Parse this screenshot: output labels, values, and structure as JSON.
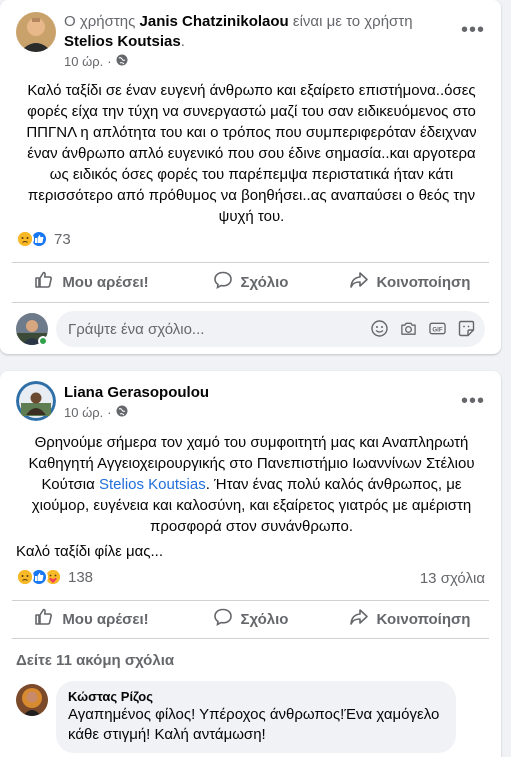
{
  "post1": {
    "header_prefix": "Ο χρήστης",
    "author": "Janis Chatzinikolaou",
    "header_middle": "είναι με το χρήστη",
    "tagged": "Stelios Koutsias",
    "header_suffix": ".",
    "time": "10 ώρ.",
    "text": "Καλό ταξίδι σε έναν ευγενή άνθρωπο και εξαίρετο επιστήμονα..όσες φορές είχα την τύχη να συνεργαστώ μαζί του σαν ειδικευόμενος στο ΠΠΓΝΛ η απλότητα του και ο τρόπος που συμπεριφερόταν έδειχναν έναν άνθρωπο απλό ευγενικό που σου έδινε σημασία..και αργοτερα ως ειδικός όσες φορές του παρέπεμψα περιστατικά ήταν κάτι περισσότερο από πρόθυμος να βοηθήσει..ας αναπαύσει ο θεός την ψυχή του.",
    "reaction_count": "73"
  },
  "actions": {
    "like": "Μου αρέσει!",
    "comment": "Σχόλιο",
    "share": "Κοινοποίηση"
  },
  "comment_box": {
    "placeholder": "Γράψτε ένα σχόλιο..."
  },
  "post2": {
    "author": "Liana Gerasopoulou",
    "time": "10 ώρ.",
    "text_before_link": "Θρηνούμε σήμερα τον χαμό του συμφοιτητή μας και Αναπληρωτή Καθηγητή Αγγειοχειρουργικής στο Πανεπιστήμιο Ιωαννίνων Στέλιου Κούτσια ",
    "link": "Stelios Koutsias",
    "text_after_link": ". Ήταν ένας πολύ καλός άνθρωπος, με χιούμορ, ευγένεια και καλοσύνη, και εξαίρετος γιατρός με αμέριστη προσφορά στον συνάνθρωπο.",
    "text2": "Καλό ταξίδι φίλε μας...",
    "reaction_count": "138",
    "comment_count": "13 σχόλια",
    "more_comments": "Δείτε 11 ακόμη σχόλια",
    "comment": {
      "author": "Κώστας Ρίζος",
      "text": "Αγαπημένος φίλος! Υπέροχος άνθρωπος!Ένα χαμόγελο κάθε στιγμή! Καλή αντάμωση!"
    }
  },
  "colors": {
    "link": "#216fdb",
    "secondary_text": "#65676b",
    "like_blue": "#1877f2",
    "sad_yellow": "#f7b928",
    "online_green": "#31a24c"
  },
  "icons": [
    "more-icon",
    "globe-icon",
    "sad-reaction-icon",
    "like-reaction-icon",
    "care-reaction-icon",
    "thumbs-up-icon",
    "comment-icon",
    "share-icon",
    "emoji-icon",
    "camera-icon",
    "gif-icon",
    "sticker-icon"
  ]
}
